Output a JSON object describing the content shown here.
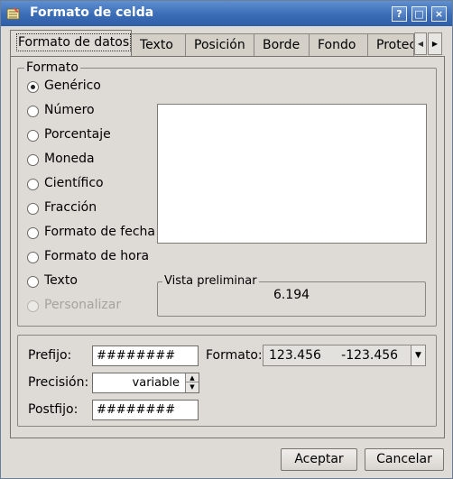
{
  "window": {
    "title": "Formato de celda",
    "controls": [
      "?",
      "□",
      "×"
    ]
  },
  "tabs": [
    {
      "label": "Formato de datos",
      "active": true
    },
    {
      "label": "Texto"
    },
    {
      "label": "Posición"
    },
    {
      "label": "Borde"
    },
    {
      "label": "Fondo"
    },
    {
      "label": "Protec"
    }
  ],
  "format_group": {
    "title": "Formato",
    "options": [
      {
        "label": "Genérico",
        "checked": true
      },
      {
        "label": "Número"
      },
      {
        "label": "Porcentaje"
      },
      {
        "label": "Moneda"
      },
      {
        "label": "Científico"
      },
      {
        "label": "Fracción"
      },
      {
        "label": "Formato de fecha"
      },
      {
        "label": "Formato de hora"
      },
      {
        "label": "Texto"
      },
      {
        "label": "Personalizar",
        "disabled": true
      }
    ]
  },
  "preview": {
    "title": "Vista preliminar",
    "value": "6.194"
  },
  "fields": {
    "prefix_label": "Prefijo:",
    "prefix_value": "########",
    "format_label": "Formato:",
    "format_value": "123.456     -123.456",
    "precision_label": "Precisión:",
    "precision_value": "variable",
    "postfix_label": "Postfijo:",
    "postfix_value": "########"
  },
  "buttons": {
    "accept": "Aceptar",
    "cancel": "Cancelar"
  },
  "colors": {
    "titlebar": "#3a6cb6",
    "window_bg": "#dedad6"
  }
}
